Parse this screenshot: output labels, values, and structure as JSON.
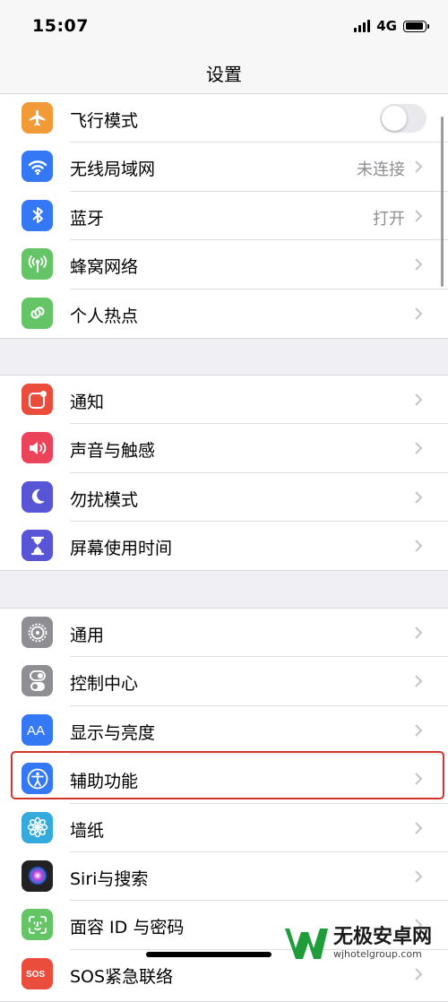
{
  "status_bar": {
    "time": "15:07",
    "network": "4G"
  },
  "nav": {
    "title": "设置"
  },
  "groups": [
    {
      "items": [
        {
          "label": "飞行模式",
          "icon": "airplane-icon",
          "color": "#f19a37",
          "control": "toggle",
          "toggle_on": false
        },
        {
          "label": "无线局域网",
          "icon": "wifi-icon",
          "color": "#3478f6",
          "detail": "未连接"
        },
        {
          "label": "蓝牙",
          "icon": "bluetooth-icon",
          "color": "#3478f6",
          "detail": "打开"
        },
        {
          "label": "蜂窝网络",
          "icon": "cellular-antenna-icon",
          "color": "#65c466"
        },
        {
          "label": "个人热点",
          "icon": "hotspot-link-icon",
          "color": "#65c466"
        }
      ]
    },
    {
      "items": [
        {
          "label": "通知",
          "icon": "notification-badge-icon",
          "color": "#eb4d3d"
        },
        {
          "label": "声音与触感",
          "icon": "speaker-icon",
          "color": "#eb445a"
        },
        {
          "label": "勿扰模式",
          "icon": "moon-icon",
          "color": "#5856d6"
        },
        {
          "label": "屏幕使用时间",
          "icon": "hourglass-icon",
          "color": "#5856d6"
        }
      ]
    },
    {
      "items": [
        {
          "label": "通用",
          "icon": "gear-icon",
          "color": "#8e8e93"
        },
        {
          "label": "控制中心",
          "icon": "control-center-icon",
          "color": "#8e8e93"
        },
        {
          "label": "显示与亮度",
          "icon": "text-size-icon",
          "color": "#3478f6"
        },
        {
          "label": "辅助功能",
          "icon": "accessibility-icon",
          "color": "#3478f6"
        },
        {
          "label": "墙纸",
          "icon": "flower-icon",
          "color": "#35aadc"
        },
        {
          "label": "Siri与搜索",
          "icon": "siri-icon",
          "color": "#222222"
        },
        {
          "label": "面容 ID 与密码",
          "icon": "face-id-icon",
          "color": "#65c466"
        },
        {
          "label": "SOS紧急联络",
          "icon": "sos-icon",
          "color": "#eb4d3d"
        }
      ]
    }
  ],
  "watermark": {
    "name": "无极安卓网",
    "url": "wjhotelgroup.com"
  }
}
